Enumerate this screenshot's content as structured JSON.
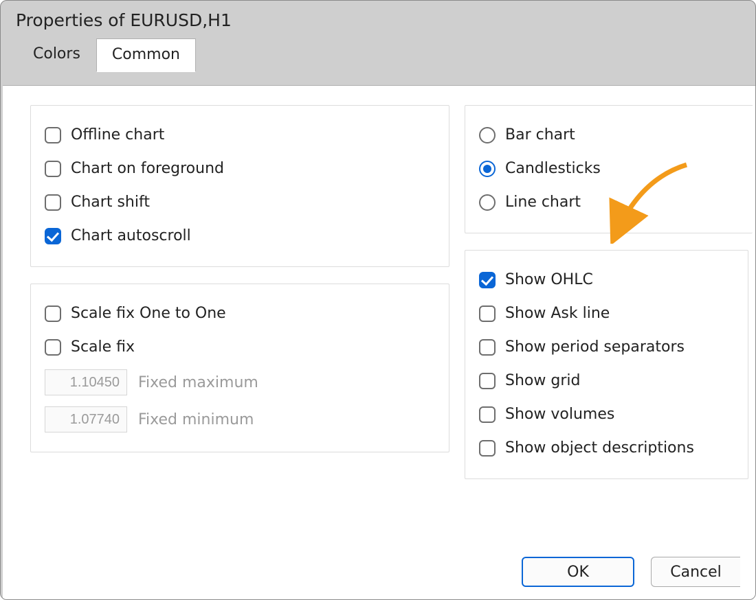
{
  "window": {
    "title": "Properties of EURUSD,H1"
  },
  "tabs": {
    "colors": "Colors",
    "common": "Common",
    "active": "common"
  },
  "left_group_a": {
    "offline_chart": {
      "label": "Offline chart",
      "checked": false
    },
    "chart_foreground": {
      "label": "Chart on foreground",
      "checked": false
    },
    "chart_shift": {
      "label": "Chart shift",
      "checked": false
    },
    "chart_autoscroll": {
      "label": "Chart autoscroll",
      "checked": true
    }
  },
  "left_group_b": {
    "scale_fix_one_to_one": {
      "label": "Scale fix One to One",
      "checked": false
    },
    "scale_fix": {
      "label": "Scale fix",
      "checked": false
    },
    "fixed_max": {
      "value": "1.10450",
      "label": "Fixed maximum"
    },
    "fixed_min": {
      "value": "1.07740",
      "label": "Fixed minimum"
    }
  },
  "right_group_a": {
    "bar_chart": "Bar chart",
    "candlesticks": "Candlesticks",
    "line_chart": "Line chart",
    "selected": "candlesticks"
  },
  "right_group_b": {
    "show_ohlc": {
      "label": "Show OHLC",
      "checked": true
    },
    "show_ask_line": {
      "label": "Show Ask line",
      "checked": false
    },
    "show_period_separators": {
      "label": "Show period separators",
      "checked": false
    },
    "show_grid": {
      "label": "Show grid",
      "checked": false
    },
    "show_volumes": {
      "label": "Show volumes",
      "checked": false
    },
    "show_object_descriptions": {
      "label": "Show object descriptions",
      "checked": false
    }
  },
  "footer": {
    "ok": "OK",
    "cancel": "Cancel"
  }
}
